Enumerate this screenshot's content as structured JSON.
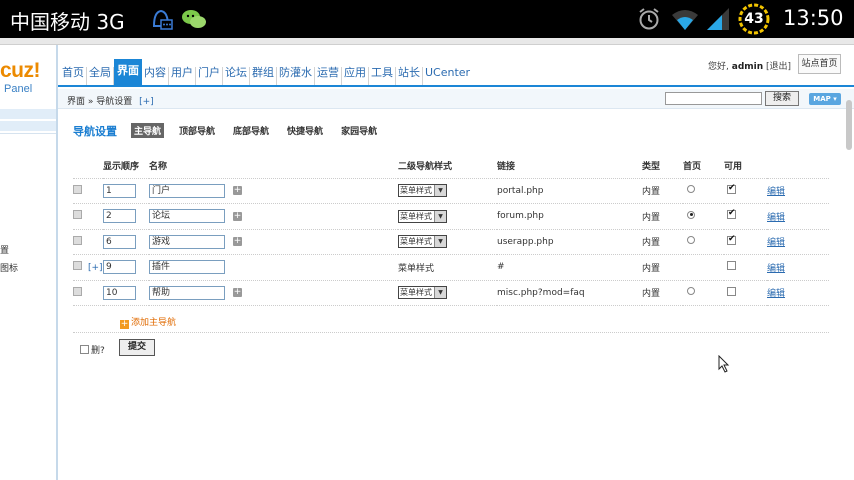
{
  "statusbar": {
    "carrier": "中国移动 3G",
    "battery": "43",
    "time": "13:50"
  },
  "sidebar": {
    "logo": "cuz!",
    "logo_sub": "Panel",
    "items": [
      "置",
      "图标"
    ]
  },
  "topnav": {
    "items": [
      {
        "label": "首页",
        "active": false
      },
      {
        "label": "全局",
        "active": false
      },
      {
        "label": "界面",
        "active": true
      },
      {
        "label": "内容",
        "active": false
      },
      {
        "label": "用户",
        "active": false
      },
      {
        "label": "门户",
        "active": false
      },
      {
        "label": "论坛",
        "active": false
      },
      {
        "label": "群组",
        "active": false
      },
      {
        "label": "防灌水",
        "active": false
      },
      {
        "label": "运营",
        "active": false
      },
      {
        "label": "应用",
        "active": false
      },
      {
        "label": "工具",
        "active": false
      },
      {
        "label": "站长",
        "active": false
      },
      {
        "label": "UCenter",
        "active": false
      }
    ],
    "greeting_prefix": "您好,",
    "username": "admin",
    "logout": "[退出]",
    "site_home": "站点首页"
  },
  "crumbbar": {
    "breadcrumb": "界面 » 导航设置",
    "add": "[+]",
    "search_button": "搜索",
    "map_button": "MAP ▾"
  },
  "content": {
    "title": "导航设置",
    "subtabs": [
      "主导航",
      "顶部导航",
      "底部导航",
      "快捷导航",
      "家园导航"
    ],
    "active_subtab": 0,
    "columns": {
      "order": "显示顺序",
      "name": "名称",
      "style": "二级导航样式",
      "link": "链接",
      "type": "类型",
      "home": "首页",
      "enabled": "可用"
    },
    "rows": [
      {
        "order": "1",
        "name": "门户",
        "has_plus": true,
        "row_add": "",
        "style": "菜单样式",
        "style_select": true,
        "link": "portal.php",
        "type": "内置",
        "home_radio": true,
        "home_checked": false,
        "enabled": true,
        "edit": "编辑"
      },
      {
        "order": "2",
        "name": "论坛",
        "has_plus": true,
        "row_add": "",
        "style": "菜单样式",
        "style_select": true,
        "link": "forum.php",
        "type": "内置",
        "home_radio": true,
        "home_checked": true,
        "enabled": true,
        "edit": "编辑"
      },
      {
        "order": "6",
        "name": "游戏",
        "has_plus": true,
        "row_add": "",
        "style": "菜单样式",
        "style_select": true,
        "link": "userapp.php",
        "type": "内置",
        "home_radio": true,
        "home_checked": false,
        "enabled": true,
        "edit": "编辑"
      },
      {
        "order": "9",
        "name": "插件",
        "has_plus": false,
        "row_add": "[+]",
        "style": "菜单样式",
        "style_select": false,
        "link": "#",
        "type": "内置",
        "home_radio": false,
        "home_checked": false,
        "enabled": false,
        "edit": "编辑"
      },
      {
        "order": "10",
        "name": "帮助",
        "has_plus": true,
        "row_add": "",
        "style": "菜单样式",
        "style_select": true,
        "link": "misc.php?mod=faq",
        "type": "内置",
        "home_radio": true,
        "home_checked": false,
        "enabled": false,
        "edit": "编辑"
      }
    ],
    "add_main_nav": "添加主导航",
    "delete_label": "删?",
    "submit": "提交"
  },
  "colors": {
    "accent": "#1b86d6",
    "link": "#2b6bb0",
    "logo": "#ec8a00",
    "add": "#e06a00"
  }
}
